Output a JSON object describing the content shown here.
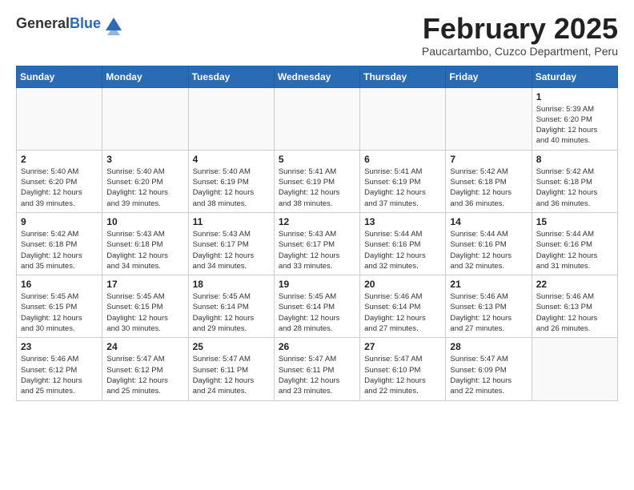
{
  "header": {
    "logo_general": "General",
    "logo_blue": "Blue",
    "month_title": "February 2025",
    "location": "Paucartambo, Cuzco Department, Peru"
  },
  "weekdays": [
    "Sunday",
    "Monday",
    "Tuesday",
    "Wednesday",
    "Thursday",
    "Friday",
    "Saturday"
  ],
  "weeks": [
    [
      {
        "day": "",
        "detail": ""
      },
      {
        "day": "",
        "detail": ""
      },
      {
        "day": "",
        "detail": ""
      },
      {
        "day": "",
        "detail": ""
      },
      {
        "day": "",
        "detail": ""
      },
      {
        "day": "",
        "detail": ""
      },
      {
        "day": "1",
        "detail": "Sunrise: 5:39 AM\nSunset: 6:20 PM\nDaylight: 12 hours\nand 40 minutes."
      }
    ],
    [
      {
        "day": "2",
        "detail": "Sunrise: 5:40 AM\nSunset: 6:20 PM\nDaylight: 12 hours\nand 39 minutes."
      },
      {
        "day": "3",
        "detail": "Sunrise: 5:40 AM\nSunset: 6:20 PM\nDaylight: 12 hours\nand 39 minutes."
      },
      {
        "day": "4",
        "detail": "Sunrise: 5:40 AM\nSunset: 6:19 PM\nDaylight: 12 hours\nand 38 minutes."
      },
      {
        "day": "5",
        "detail": "Sunrise: 5:41 AM\nSunset: 6:19 PM\nDaylight: 12 hours\nand 38 minutes."
      },
      {
        "day": "6",
        "detail": "Sunrise: 5:41 AM\nSunset: 6:19 PM\nDaylight: 12 hours\nand 37 minutes."
      },
      {
        "day": "7",
        "detail": "Sunrise: 5:42 AM\nSunset: 6:18 PM\nDaylight: 12 hours\nand 36 minutes."
      },
      {
        "day": "8",
        "detail": "Sunrise: 5:42 AM\nSunset: 6:18 PM\nDaylight: 12 hours\nand 36 minutes."
      }
    ],
    [
      {
        "day": "9",
        "detail": "Sunrise: 5:42 AM\nSunset: 6:18 PM\nDaylight: 12 hours\nand 35 minutes."
      },
      {
        "day": "10",
        "detail": "Sunrise: 5:43 AM\nSunset: 6:18 PM\nDaylight: 12 hours\nand 34 minutes."
      },
      {
        "day": "11",
        "detail": "Sunrise: 5:43 AM\nSunset: 6:17 PM\nDaylight: 12 hours\nand 34 minutes."
      },
      {
        "day": "12",
        "detail": "Sunrise: 5:43 AM\nSunset: 6:17 PM\nDaylight: 12 hours\nand 33 minutes."
      },
      {
        "day": "13",
        "detail": "Sunrise: 5:44 AM\nSunset: 6:16 PM\nDaylight: 12 hours\nand 32 minutes."
      },
      {
        "day": "14",
        "detail": "Sunrise: 5:44 AM\nSunset: 6:16 PM\nDaylight: 12 hours\nand 32 minutes."
      },
      {
        "day": "15",
        "detail": "Sunrise: 5:44 AM\nSunset: 6:16 PM\nDaylight: 12 hours\nand 31 minutes."
      }
    ],
    [
      {
        "day": "16",
        "detail": "Sunrise: 5:45 AM\nSunset: 6:15 PM\nDaylight: 12 hours\nand 30 minutes."
      },
      {
        "day": "17",
        "detail": "Sunrise: 5:45 AM\nSunset: 6:15 PM\nDaylight: 12 hours\nand 30 minutes."
      },
      {
        "day": "18",
        "detail": "Sunrise: 5:45 AM\nSunset: 6:14 PM\nDaylight: 12 hours\nand 29 minutes."
      },
      {
        "day": "19",
        "detail": "Sunrise: 5:45 AM\nSunset: 6:14 PM\nDaylight: 12 hours\nand 28 minutes."
      },
      {
        "day": "20",
        "detail": "Sunrise: 5:46 AM\nSunset: 6:14 PM\nDaylight: 12 hours\nand 27 minutes."
      },
      {
        "day": "21",
        "detail": "Sunrise: 5:46 AM\nSunset: 6:13 PM\nDaylight: 12 hours\nand 27 minutes."
      },
      {
        "day": "22",
        "detail": "Sunrise: 5:46 AM\nSunset: 6:13 PM\nDaylight: 12 hours\nand 26 minutes."
      }
    ],
    [
      {
        "day": "23",
        "detail": "Sunrise: 5:46 AM\nSunset: 6:12 PM\nDaylight: 12 hours\nand 25 minutes."
      },
      {
        "day": "24",
        "detail": "Sunrise: 5:47 AM\nSunset: 6:12 PM\nDaylight: 12 hours\nand 25 minutes."
      },
      {
        "day": "25",
        "detail": "Sunrise: 5:47 AM\nSunset: 6:11 PM\nDaylight: 12 hours\nand 24 minutes."
      },
      {
        "day": "26",
        "detail": "Sunrise: 5:47 AM\nSunset: 6:11 PM\nDaylight: 12 hours\nand 23 minutes."
      },
      {
        "day": "27",
        "detail": "Sunrise: 5:47 AM\nSunset: 6:10 PM\nDaylight: 12 hours\nand 22 minutes."
      },
      {
        "day": "28",
        "detail": "Sunrise: 5:47 AM\nSunset: 6:09 PM\nDaylight: 12 hours\nand 22 minutes."
      },
      {
        "day": "",
        "detail": ""
      }
    ]
  ]
}
